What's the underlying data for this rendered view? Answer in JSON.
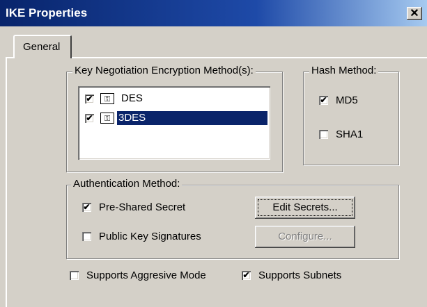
{
  "window": {
    "title": "IKE Properties",
    "close_glyph": "✕"
  },
  "tabs": [
    {
      "label": "General"
    }
  ],
  "encryption": {
    "legend": "Key Negotiation Encryption Method(s):",
    "items": [
      {
        "label": "DES",
        "checked": true,
        "selected": false,
        "icon": "key-icon"
      },
      {
        "label": "3DES",
        "checked": true,
        "selected": true,
        "icon": "key-icon"
      }
    ]
  },
  "hash": {
    "legend": "Hash Method:",
    "md5": {
      "label": "MD5",
      "checked": true
    },
    "sha1": {
      "label": "SHA1",
      "checked": false
    }
  },
  "auth": {
    "legend": "Authentication Method:",
    "preshared": {
      "label": "Pre-Shared Secret",
      "checked": true
    },
    "pubkey": {
      "label": "Public Key Signatures",
      "checked": false
    },
    "edit_secrets": "Edit Secrets...",
    "configure": "Configure..."
  },
  "options": {
    "aggressive": {
      "label": "Supports Aggresive Mode",
      "checked": false
    },
    "subnets": {
      "label": "Supports Subnets",
      "checked": true
    }
  },
  "colors": {
    "selection": "#0a246a",
    "titlebar": "#08246b",
    "face": "#d4d0c8"
  }
}
